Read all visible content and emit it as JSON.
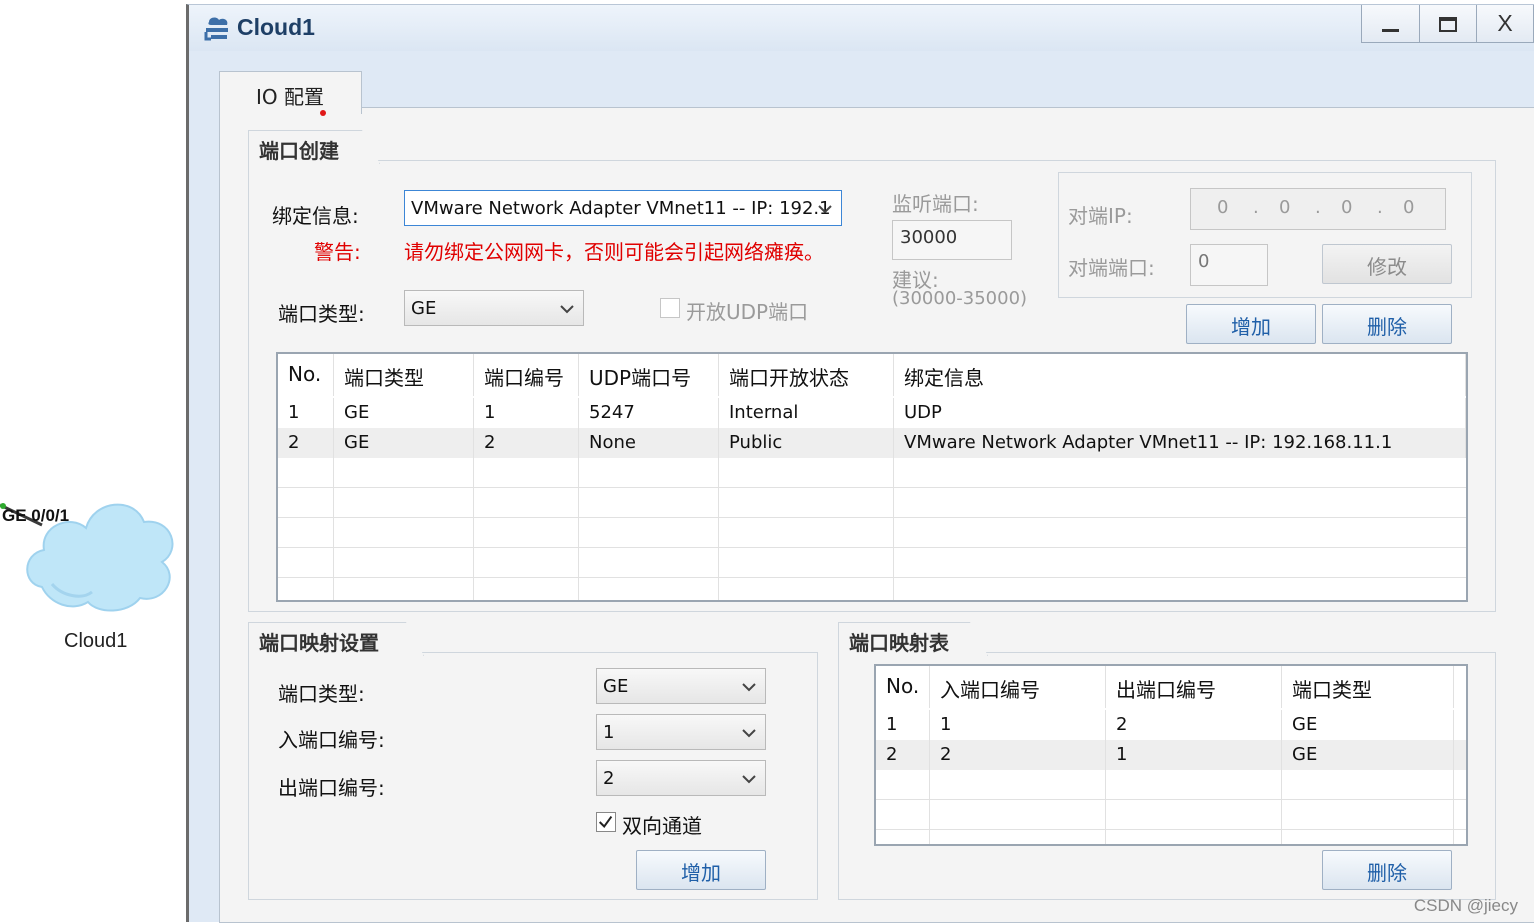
{
  "topology": {
    "port_label": "GE 0/0/1",
    "device_name": "Cloud1"
  },
  "window": {
    "title": "Cloud1",
    "min_label": "",
    "max_label": "",
    "close_label": "X"
  },
  "tab": {
    "label": "IO 配置"
  },
  "port_create": {
    "group_title": "端口创建",
    "bind_label": "绑定信息:",
    "bind_value": "VMware Network Adapter VMnet11 -- IP: 192.1",
    "warning_label": "警告:",
    "warning_text": "请勿绑定公网网卡，否则可能会引起网络瘫痪。",
    "port_type_label": "端口类型:",
    "port_type_value": "GE",
    "udp_checkbox_label": "开放UDP端口",
    "udp_checked": false,
    "listen_port_label": "监听端口:",
    "listen_port_value": "30000",
    "suggest_label": "建议:",
    "suggest_range": "(30000-35000)",
    "peer_ip_label": "对端IP:",
    "peer_ip_octets": [
      "0",
      "0",
      "0",
      "0"
    ],
    "peer_ip_dots": ".",
    "peer_port_label": "对端端口:",
    "peer_port_value": "0",
    "modify_button": "修改",
    "add_button": "增加",
    "delete_button": "删除",
    "table": {
      "headers": [
        "No.",
        "端口类型",
        "端口编号",
        "UDP端口号",
        "端口开放状态",
        "绑定信息"
      ],
      "rows": [
        [
          "1",
          "GE",
          "1",
          "5247",
          "Internal",
          "UDP"
        ],
        [
          "2",
          "GE",
          "2",
          "None",
          "Public",
          "VMware Network Adapter VMnet11 -- IP: 192.168.11.1"
        ]
      ]
    }
  },
  "mapping_settings": {
    "group_title": "端口映射设置",
    "port_type_label": "端口类型:",
    "port_type_value": "GE",
    "in_port_label": "入端口编号:",
    "in_port_value": "1",
    "out_port_label": "出端口编号:",
    "out_port_value": "2",
    "bidirectional_label": "双向通道",
    "bidirectional_checked": true,
    "add_button": "增加"
  },
  "mapping_table": {
    "group_title": "端口映射表",
    "headers": [
      "No.",
      "入端口编号",
      "出端口编号",
      "端口类型"
    ],
    "rows": [
      [
        "1",
        "1",
        "2",
        "GE"
      ],
      [
        "2",
        "2",
        "1",
        "GE"
      ]
    ],
    "delete_button": "删除"
  },
  "watermark": "CSDN @jiecy",
  "colors": {
    "warning": "#e00000",
    "title_text": "#1e3f66",
    "button_text": "#1f5fa8",
    "cloud": "#bfe6f8"
  }
}
